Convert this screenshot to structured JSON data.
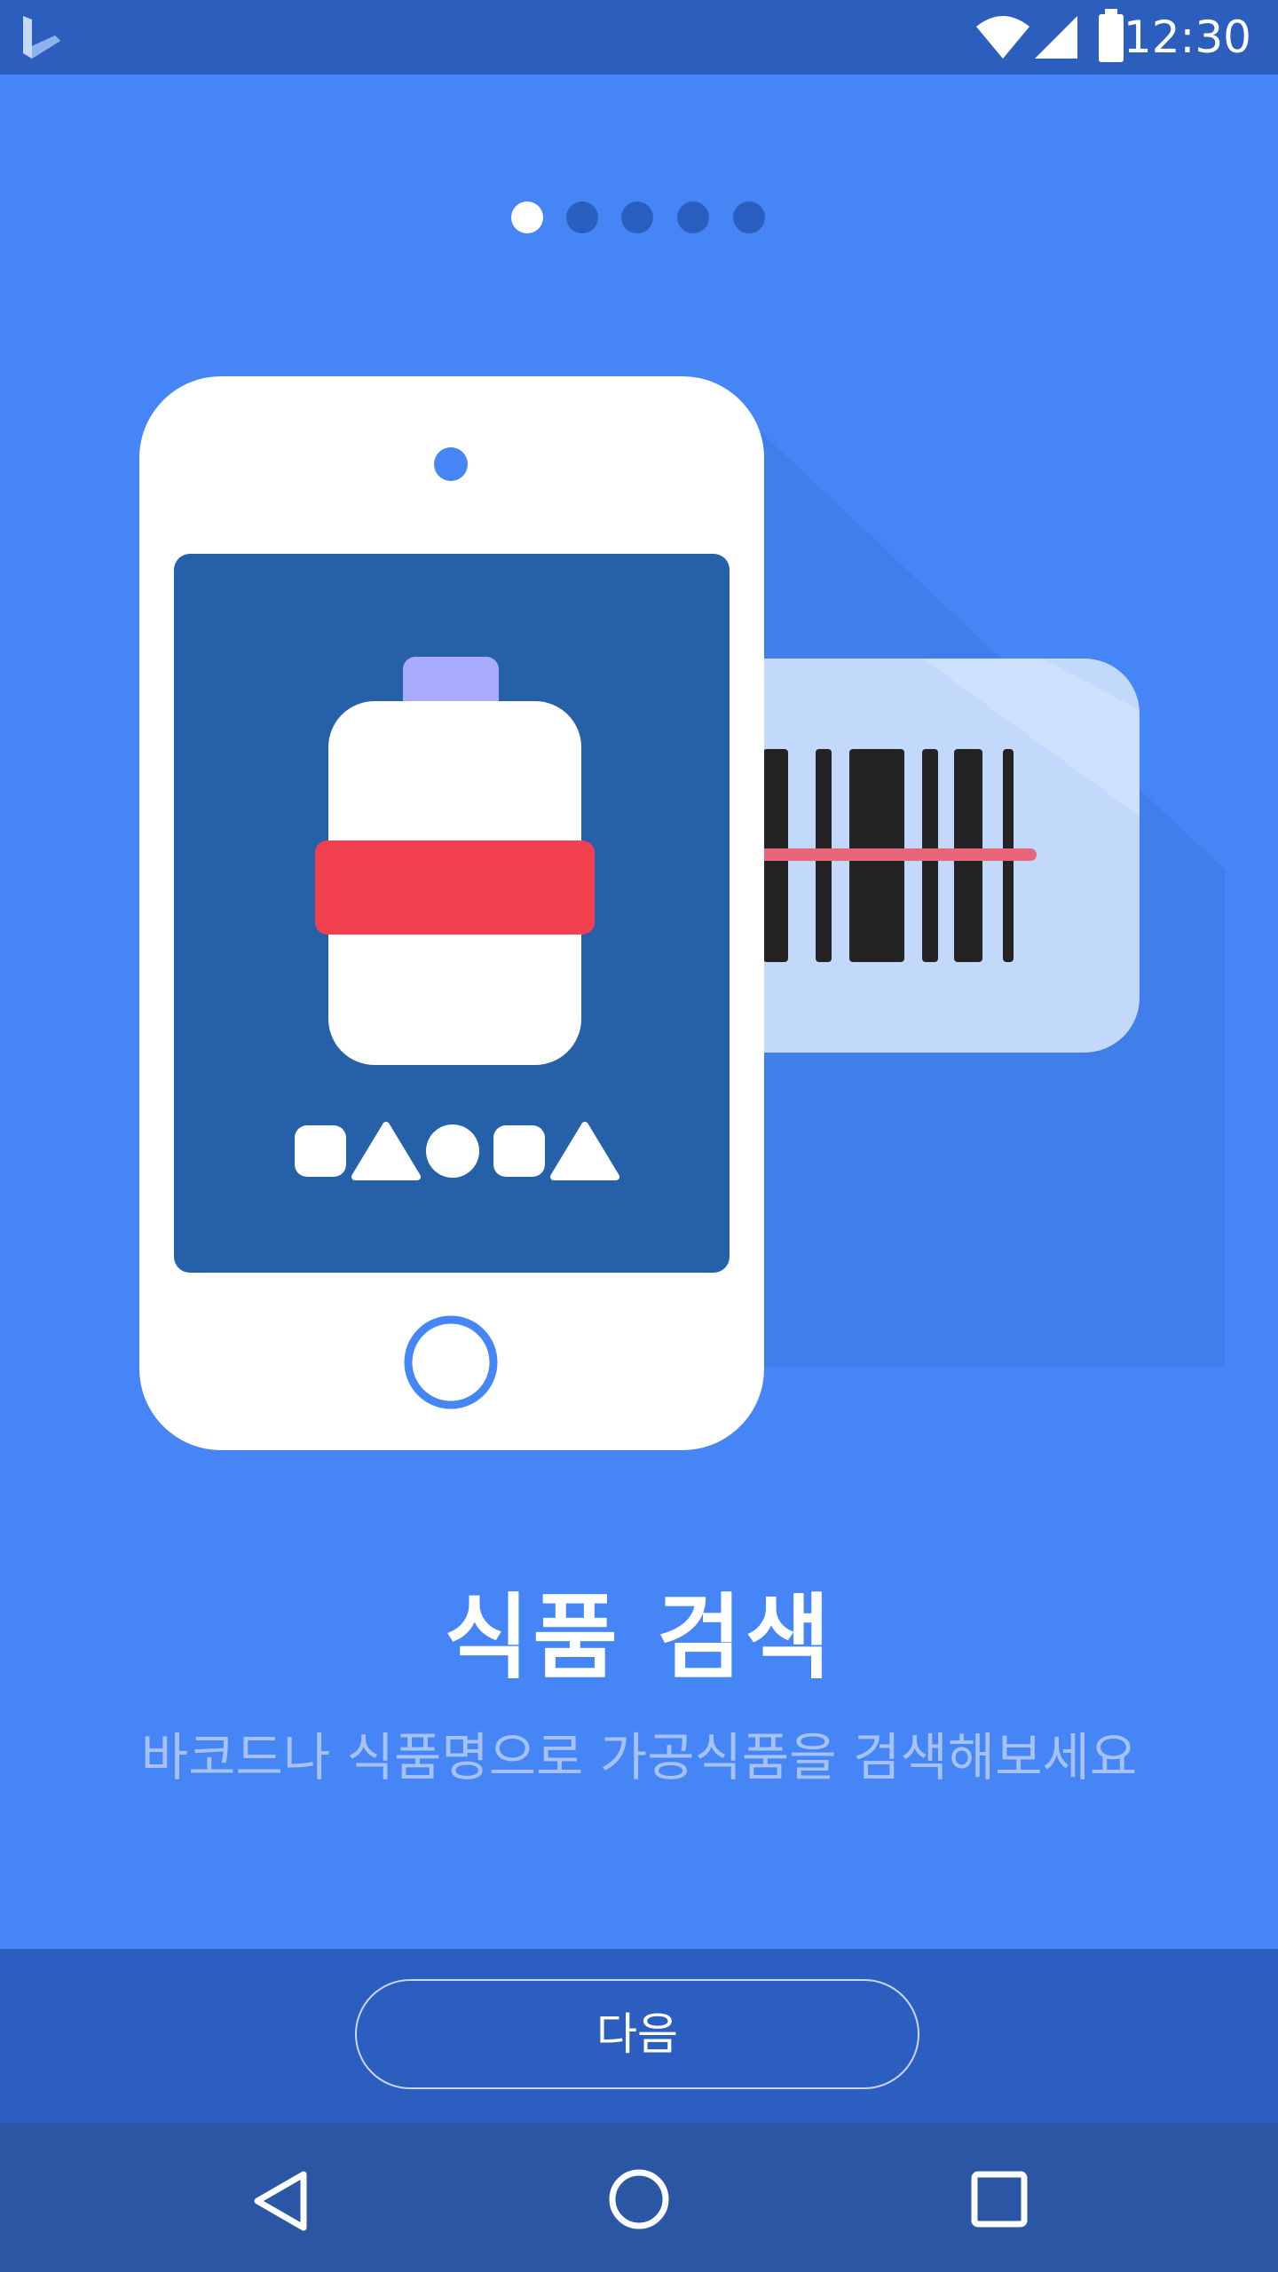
{
  "status_bar": {
    "app_icon": "bing-logo-icon",
    "time": "12:30",
    "icons": [
      "wifi-icon",
      "signal-icon",
      "battery-icon"
    ]
  },
  "pager": {
    "total_pages": 5,
    "current_page": 1
  },
  "onboarding": {
    "title": "식품 검색",
    "subtitle": "바코드나 식품명으로 가공식품을 검색해보세요"
  },
  "footer": {
    "next_label": "다음"
  },
  "nav_bar": {
    "buttons": [
      "back-icon",
      "home-icon",
      "recents-icon"
    ]
  },
  "colors": {
    "background": "#4585f5",
    "status_bar": "#2b5ebd",
    "button_area": "#2c5ebf",
    "nav_bar": "#2a56a3",
    "phone_screen": "#2660a8",
    "barcode_card": "#c2d9fc",
    "scan_line": "#e9667a",
    "product_band": "#f2404f",
    "product_cap": "#aaaaff"
  }
}
